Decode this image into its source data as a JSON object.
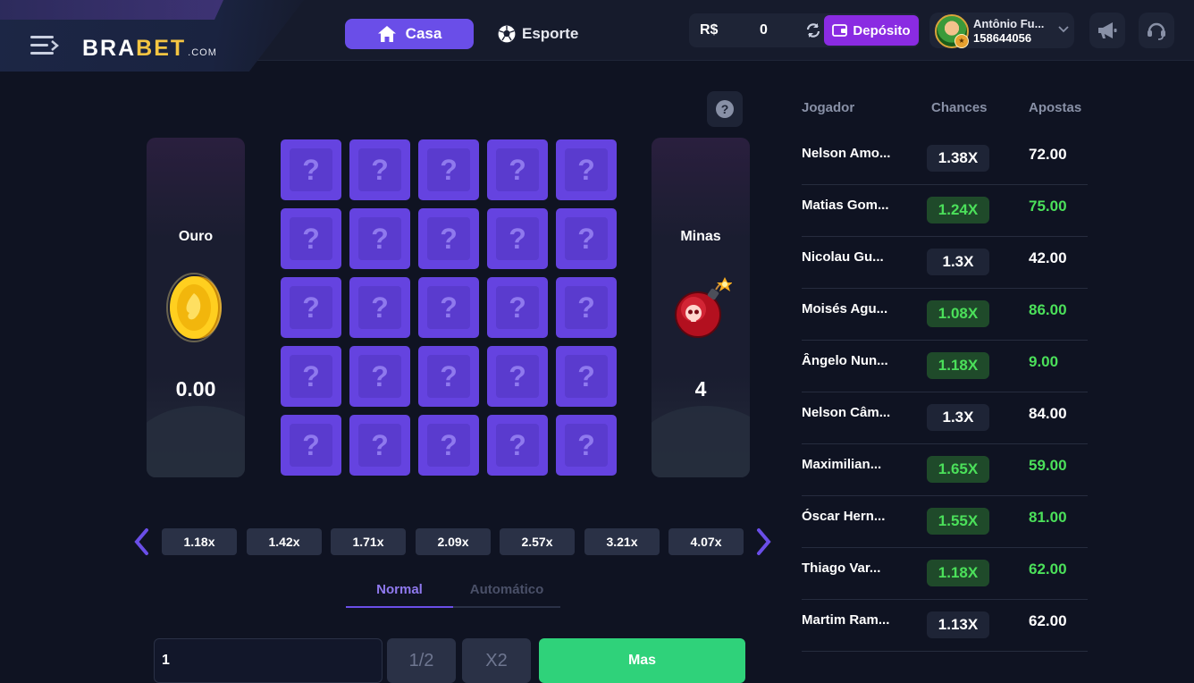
{
  "header": {
    "logo": {
      "part1": "BRA",
      "part2": "BET",
      "suffix": ".COM"
    },
    "nav": {
      "casa": "Casa",
      "esporte": "Esporte"
    },
    "balance": {
      "currency": "R$",
      "value": "0"
    },
    "deposit_label": "Depósito",
    "user": {
      "name": "Antônio Fu...",
      "id": "158644056"
    }
  },
  "game": {
    "gold": {
      "title": "Ouro",
      "value": "0.00"
    },
    "mines": {
      "title": "Minas",
      "value": "4"
    },
    "tile_symbol": "?",
    "grid_size": 5,
    "multipliers": [
      "1.18x",
      "1.42x",
      "1.71x",
      "2.09x",
      "2.57x",
      "3.21x",
      "4.07x"
    ],
    "tabs": {
      "normal": "Normal",
      "auto": "Automático"
    },
    "amount_value": "1",
    "half_label": "1/2",
    "double_label": "X2",
    "bet_label": "Mas",
    "help_symbol": "?"
  },
  "table": {
    "headers": {
      "player": "Jogador",
      "chances": "Chances",
      "bets": "Apostas"
    },
    "rows": [
      {
        "name": "Nelson Amo...",
        "chance": "1.38X",
        "bet": "72.00",
        "win": false
      },
      {
        "name": "Matias Gom...",
        "chance": "1.24X",
        "bet": "75.00",
        "win": true
      },
      {
        "name": "Nicolau Gu...",
        "chance": "1.3X",
        "bet": "42.00",
        "win": false
      },
      {
        "name": "Moisés Agu...",
        "chance": "1.08X",
        "bet": "86.00",
        "win": true
      },
      {
        "name": "Ângelo Nun...",
        "chance": "1.18X",
        "bet": "9.00",
        "win": true
      },
      {
        "name": "Nelson Câm...",
        "chance": "1.3X",
        "bet": "84.00",
        "win": false
      },
      {
        "name": "Maximilian...",
        "chance": "1.65X",
        "bet": "59.00",
        "win": true
      },
      {
        "name": "Óscar Hern...",
        "chance": "1.55X",
        "bet": "81.00",
        "win": true
      },
      {
        "name": "Thiago Var...",
        "chance": "1.18X",
        "bet": "62.00",
        "win": true
      },
      {
        "name": "Martim Ram...",
        "chance": "1.13X",
        "bet": "62.00",
        "win": false
      }
    ]
  },
  "colors": {
    "accent": "#6a4ee8",
    "win_green": "#4be05a",
    "win_bg": "#1f4a2a",
    "lose_bg": "#1e2436",
    "deposit": "#8a2be2",
    "bet_button": "#2fd27a"
  }
}
